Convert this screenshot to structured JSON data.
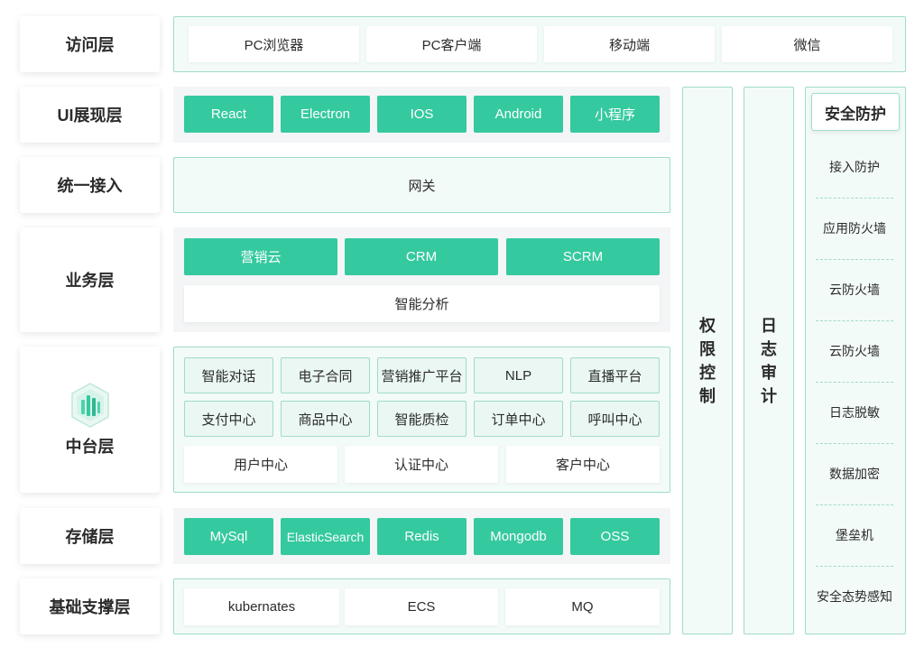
{
  "layers": [
    {
      "label": "访问层"
    },
    {
      "label": "UI展现层"
    },
    {
      "label": "统一接入"
    },
    {
      "label": "业务层"
    },
    {
      "label": "中台层"
    },
    {
      "label": "存储层"
    },
    {
      "label": "基础支撑层"
    }
  ],
  "access": [
    "PC浏览器",
    "PC客户端",
    "移动端",
    "微信"
  ],
  "ui": [
    "React",
    "Electron",
    "IOS",
    "Android",
    "小程序"
  ],
  "gateway": "网关",
  "business": {
    "top": [
      "营销云",
      "CRM",
      "SCRM"
    ],
    "bottom": "智能分析"
  },
  "middle": {
    "row1": [
      "智能对话",
      "电子合同",
      "营销推广平台",
      "NLP",
      "直播平台"
    ],
    "row2": [
      "支付中心",
      "商品中心",
      "智能质检",
      "订单中心",
      "呼叫中心"
    ],
    "row3": [
      "用户中心",
      "认证中心",
      "客户中心"
    ]
  },
  "storage": [
    "MySql",
    "ElasticSearch",
    "Redis",
    "Mongodb",
    "OSS"
  ],
  "infra": [
    "kubernates",
    "ECS",
    "MQ"
  ],
  "columns": {
    "permission": [
      "权",
      "限",
      "控",
      "制"
    ],
    "audit": [
      "日",
      "志",
      "审",
      "计"
    ]
  },
  "security": {
    "title": "安全防护",
    "items": [
      "接入防护",
      "应用防火墙",
      "云防火墙",
      "云防火墙",
      "日志脱敏",
      "数据加密",
      "堡垒机",
      "安全态势感知"
    ]
  },
  "colors": {
    "accent": "#35c9a0",
    "border": "#9fdcc7",
    "panel": "#f3fbf8"
  }
}
